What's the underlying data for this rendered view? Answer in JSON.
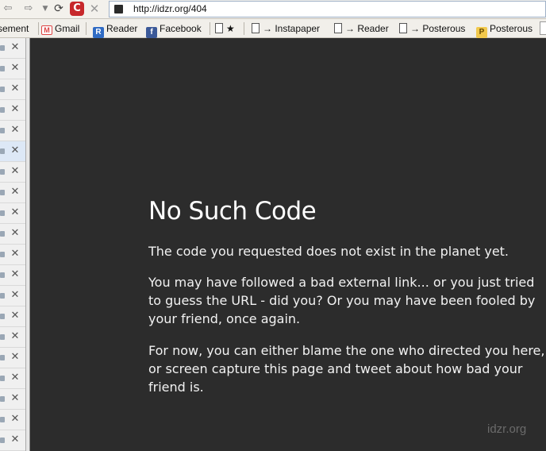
{
  "browser": {
    "url": "http://idzr.org/404",
    "icons": {
      "back": "back-arrow-icon",
      "forward": "forward-arrow-icon",
      "history": "history-dropdown-icon",
      "reload": "reload-icon",
      "stop": "stop-icon"
    }
  },
  "bookmarks": [
    {
      "label": "sement",
      "icon": "none"
    },
    {
      "label": "Gmail",
      "icon": "gmail-icon"
    },
    {
      "label": "Reader",
      "icon": "google-reader-icon"
    },
    {
      "label": "Facebook",
      "icon": "facebook-icon"
    },
    {
      "label": "★",
      "icon": "page-icon"
    },
    {
      "label": "→ Instapaper",
      "icon": "page-icon"
    },
    {
      "label": "→ Reader",
      "icon": "page-icon"
    },
    {
      "label": "→ Posterous",
      "icon": "page-icon"
    },
    {
      "label": "Posterous",
      "icon": "posterous-icon"
    }
  ],
  "sidebar": {
    "tab_count": 20,
    "active_tab_index": 5,
    "close_glyph": "✕"
  },
  "page": {
    "heading": "No Such Code",
    "paragraphs": [
      "The code you requested does not exist in the planet yet.",
      "You may have followed a bad external link... or you just tried to guess the URL - did you? Or you may have been fooled by your friend, once again.",
      "For now, you can either blame the one who directed you here, or screen capture this page and tweet about how bad your friend is."
    ],
    "footer": "idzr.org"
  },
  "colors": {
    "page_background": "#2c2c2c",
    "heading": "#ffffff",
    "body_text": "#f2f2f2",
    "footer_text": "#6b6b6b",
    "stop_button": "#c7282b"
  }
}
